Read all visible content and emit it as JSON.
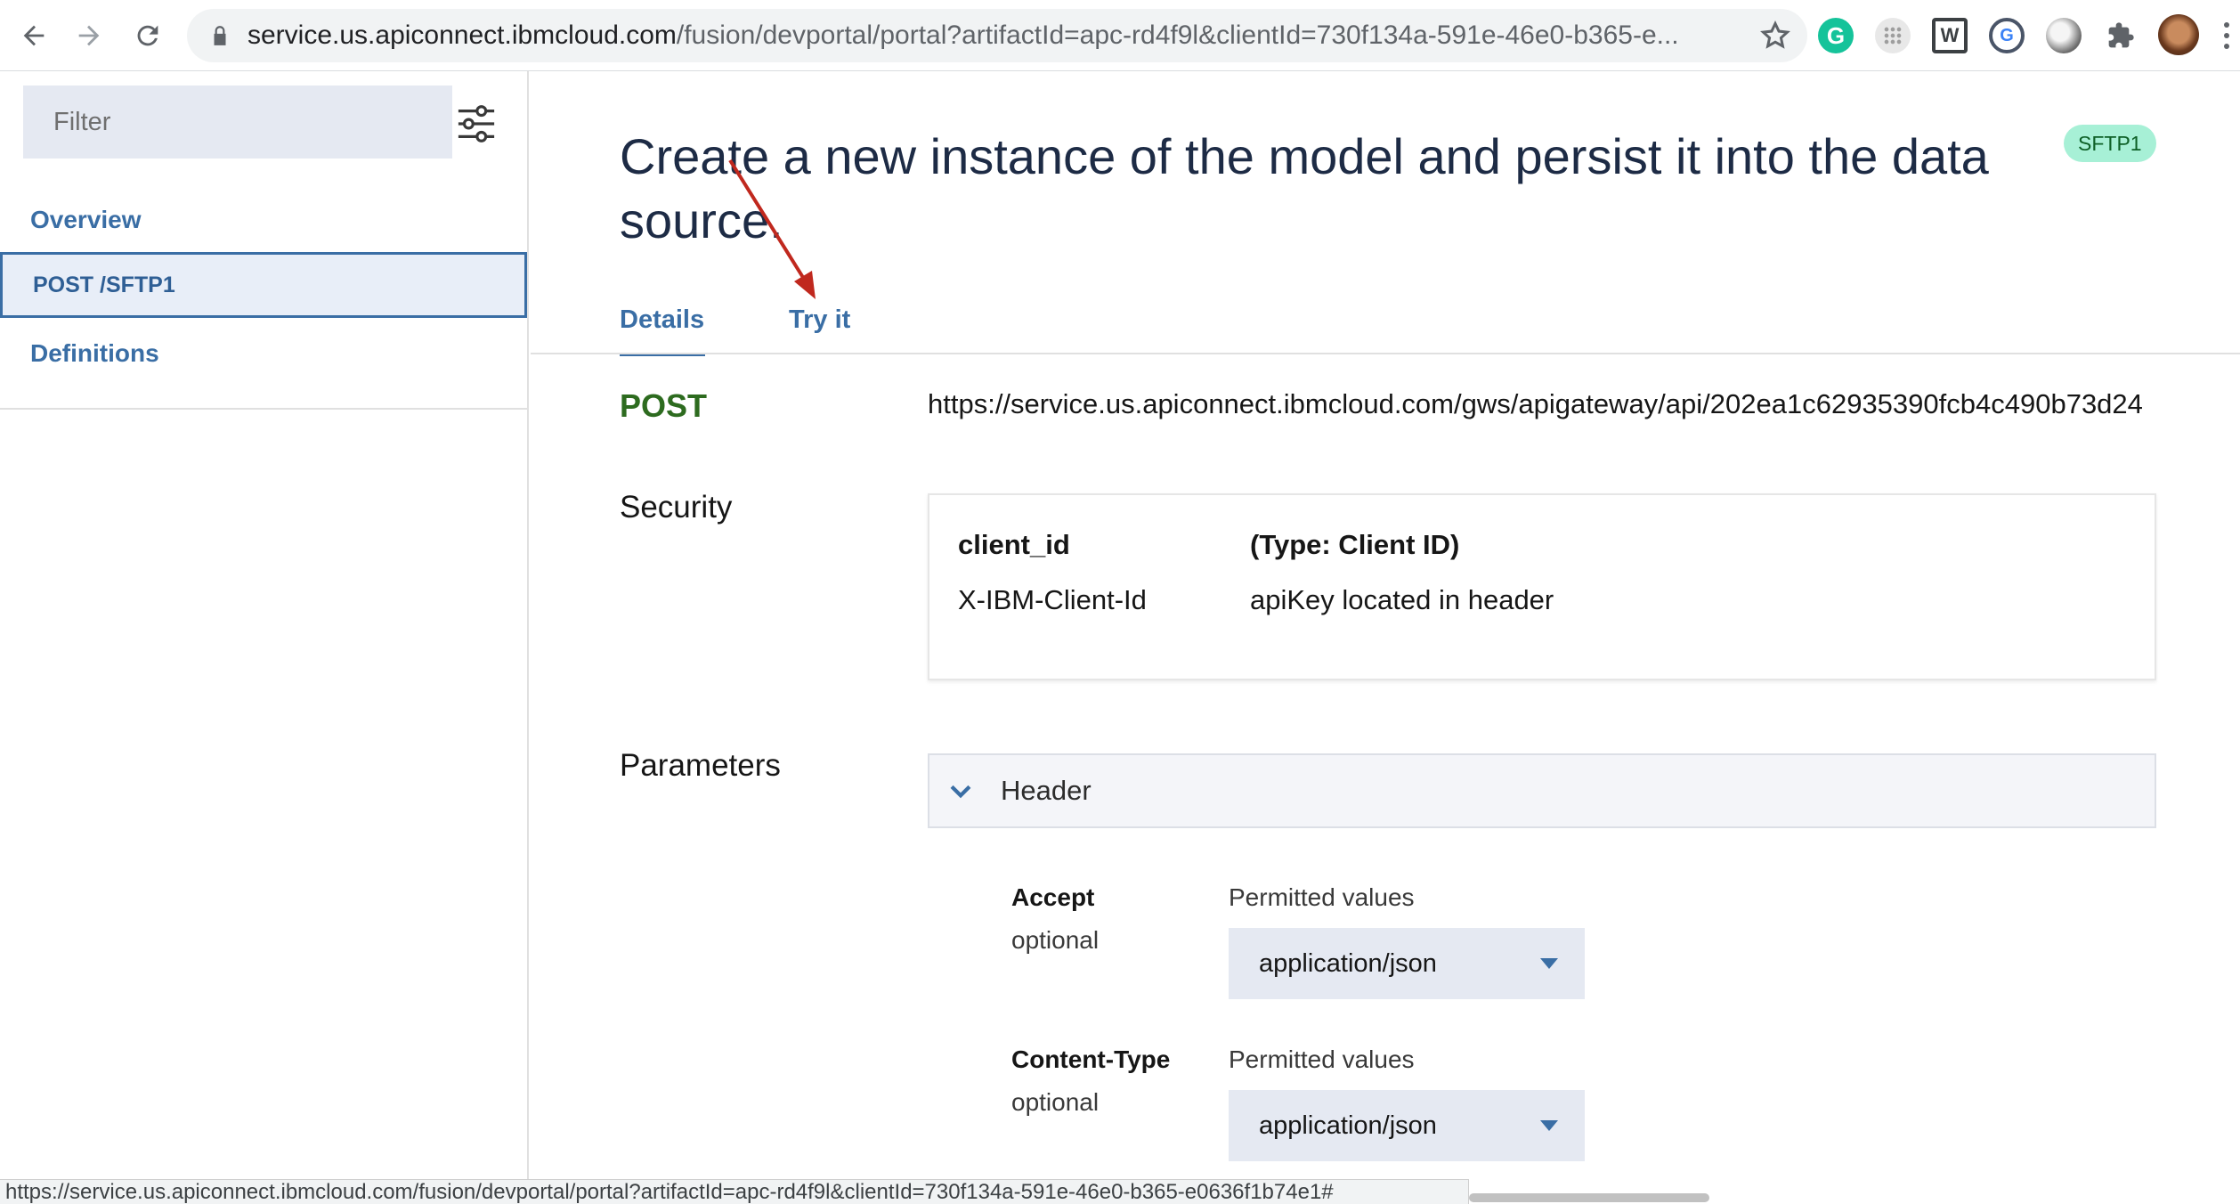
{
  "browser": {
    "url_host": "service.us.apiconnect.ibmcloud.com",
    "url_rest": "/fusion/devportal/portal?artifactId=apc-rd4f9l&clientId=730f134a-591e-46e0-b365-e...",
    "status_url": "https://service.us.apiconnect.ibmcloud.com/fusion/devportal/portal?artifactId=apc-rd4f9l&clientId=730f134a-591e-46e0-b365-e0636f1b74e1#",
    "icons": [
      "back-icon",
      "forward-icon",
      "reload-icon",
      "lock-icon",
      "star-icon",
      "grammarly-icon",
      "extension-icon",
      "w-extension-icon",
      "g-extension-icon",
      "circle-extension-icon",
      "puzzle-icon",
      "avatar"
    ],
    "grammarly_letter": "G",
    "w_letter": "W",
    "g_letter": "G"
  },
  "sidebar": {
    "filter_placeholder": "Filter",
    "items": [
      {
        "label": "Overview"
      },
      {
        "label": "POST /SFTP1"
      },
      {
        "label": "Definitions"
      }
    ]
  },
  "main": {
    "title": "Create a new instance of the model and persist it into the data source.",
    "badge": "SFTP1",
    "tabs": [
      {
        "label": "Details"
      },
      {
        "label": "Try it"
      }
    ],
    "method": "POST",
    "endpoint": "https://service.us.apiconnect.ibmcloud.com/gws/apigateway/api/202ea1c62935390fcb4c490b73d24",
    "security": {
      "section_label": "Security",
      "name": "client_id",
      "type": "(Type: Client ID)",
      "header_name": "X-IBM-Client-Id",
      "location": "apiKey located in header"
    },
    "parameters": {
      "section_label": "Parameters",
      "group_label": "Header",
      "items": [
        {
          "name": "Accept",
          "required": "optional",
          "permitted_label": "Permitted values",
          "value": "application/json"
        },
        {
          "name": "Content-Type",
          "required": "optional",
          "permitted_label": "Permitted values",
          "value": "application/json"
        }
      ]
    }
  },
  "colors": {
    "link": "#3a6ea5",
    "method_green": "#2d6b1f",
    "badge_bg": "#a7f0d6",
    "annotation_arrow": "#c0281e"
  }
}
